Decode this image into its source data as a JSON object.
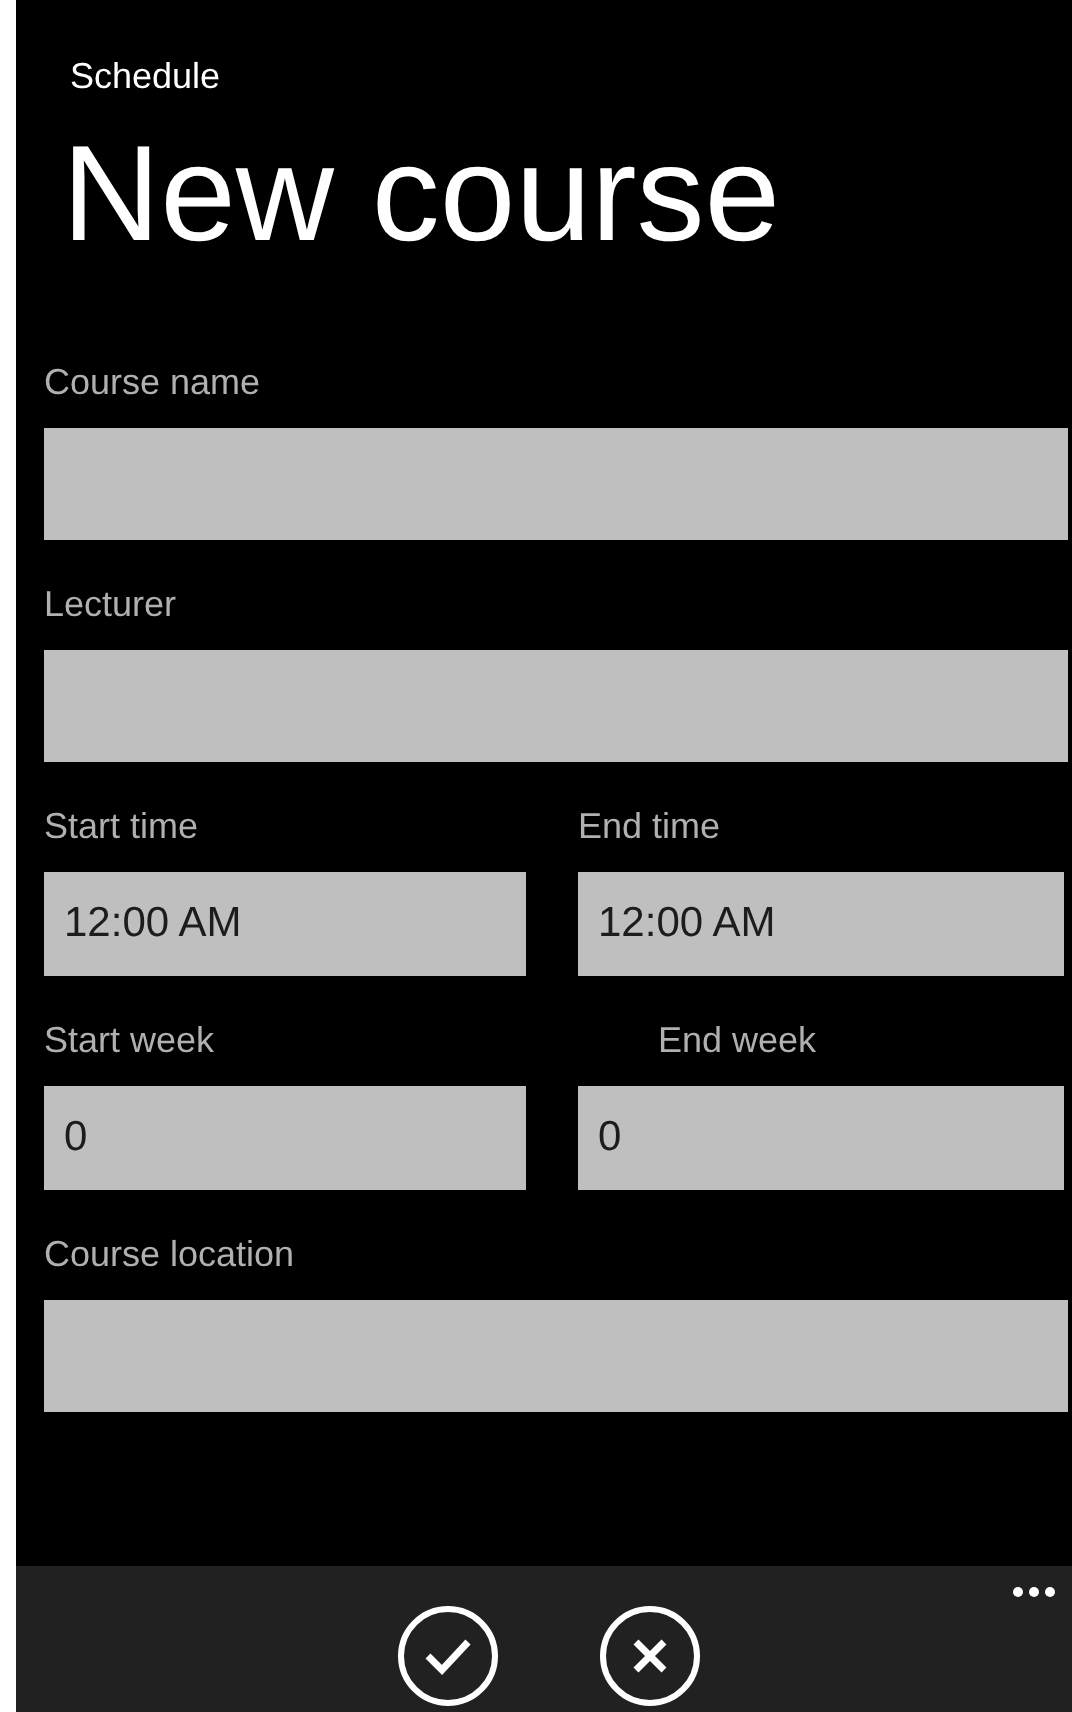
{
  "header": {
    "app_title": "Schedule",
    "page_title": "New course"
  },
  "form": [
    {
      "kind": "single",
      "label": "Course name"
    },
    {
      "kind": "single",
      "label": "Lecturer"
    },
    {
      "kind": "pair",
      "fields": [
        {
          "label": "Start time",
          "value": "12:00 AM"
        },
        {
          "label": "End time",
          "value": "12:00 AM"
        }
      ]
    },
    {
      "kind": "pair",
      "fields": [
        {
          "label": "Start week",
          "value": "0"
        },
        {
          "label": "End week",
          "value": "0"
        }
      ]
    },
    {
      "kind": "single",
      "label": "Course location"
    }
  ],
  "app_bar": {
    "buttons": [
      {
        "kind": "confirm"
      },
      {
        "kind": "cancel"
      }
    ]
  }
}
